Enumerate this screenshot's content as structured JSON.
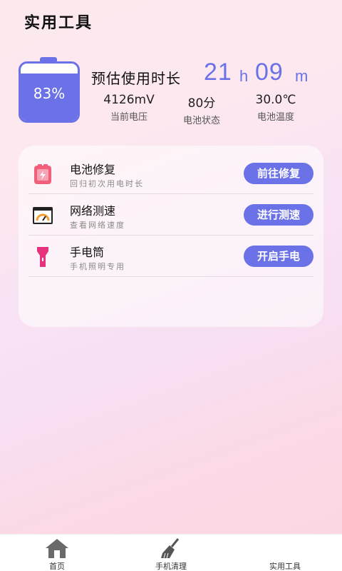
{
  "header": {
    "title": "实用工具"
  },
  "battery": {
    "percent_label": "83%",
    "level": 0.83,
    "color": "#6b71e6"
  },
  "estimate": {
    "label": "预估使用时长",
    "hours": "21",
    "hours_unit": "h",
    "minutes": "09",
    "minutes_unit": "m"
  },
  "stats": [
    {
      "value": "4126mV",
      "label": "当前电压"
    },
    {
      "value": "80分",
      "label": "电池状态"
    },
    {
      "value": "30.0℃",
      "label": "电池温度"
    }
  ],
  "tools": [
    {
      "icon": "battery-repair-icon",
      "title": "电池修复",
      "subtitle": "回归初次用电时长",
      "button": "前往修复"
    },
    {
      "icon": "speedometer-icon",
      "title": "网络测速",
      "subtitle": "查看网络速度",
      "button": "进行测速"
    },
    {
      "icon": "flashlight-icon",
      "title": "手电筒",
      "subtitle": "手机照明专用",
      "button": "开启手电"
    }
  ],
  "tabbar": {
    "items": [
      {
        "icon": "home-icon",
        "label": "首页"
      },
      {
        "icon": "broom-icon",
        "label": "手机清理"
      },
      {
        "icon": "tools-icon",
        "label": "实用工具"
      }
    ]
  },
  "colors": {
    "accent": "#6b71e6",
    "battery_icon": "#f0607a",
    "flashlight_icon": "#e8317c"
  }
}
